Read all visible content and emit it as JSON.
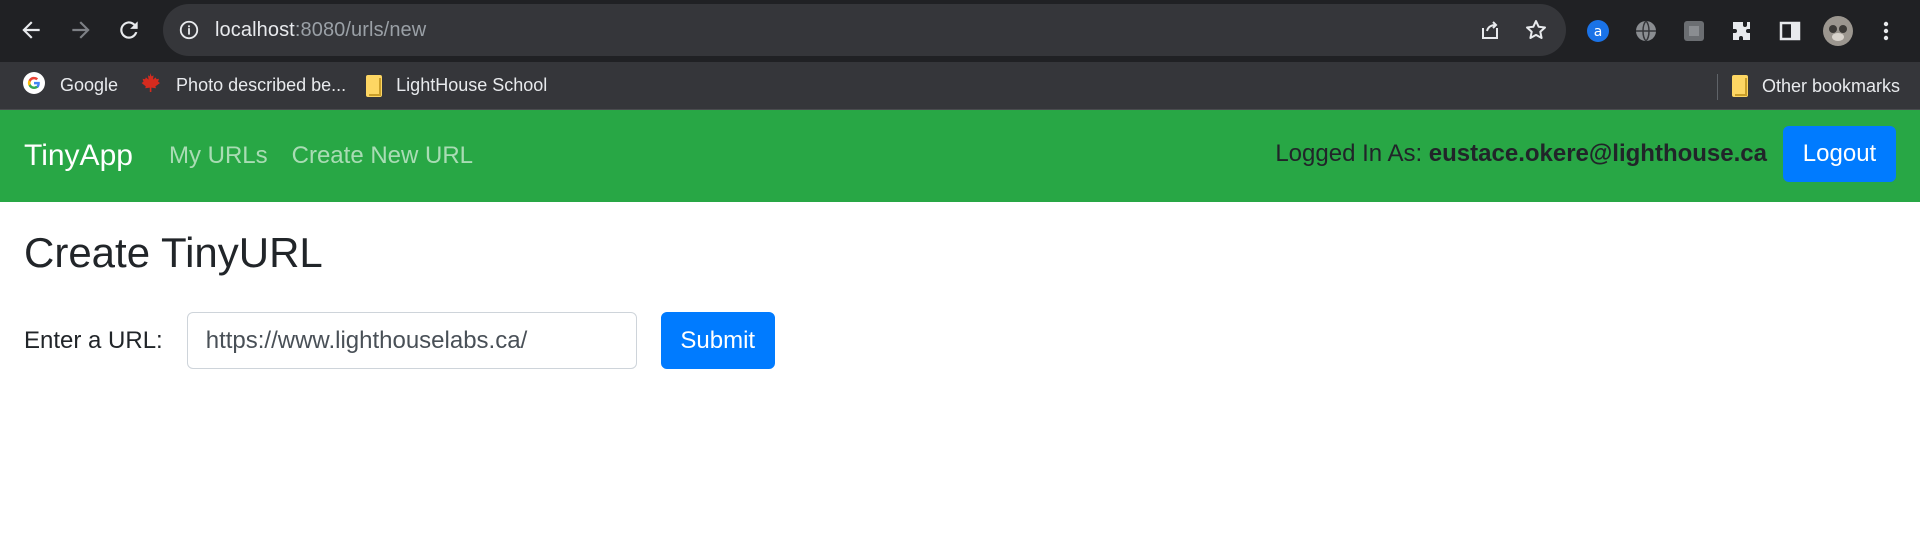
{
  "browser": {
    "url_host": "localhost",
    "url_rest": ":8080/urls/new",
    "bookmarks": [
      {
        "label": "Google",
        "icon": "google-icon"
      },
      {
        "label": "Photo described be...",
        "icon": "maple-leaf-icon"
      },
      {
        "label": "LightHouse School",
        "icon": "folder-icon"
      }
    ],
    "other_bookmarks": "Other bookmarks"
  },
  "navbar": {
    "brand": "TinyApp",
    "links": [
      "My URLs",
      "Create New URL"
    ],
    "logged_in_prefix": "Logged In As:",
    "user_email": "eustace.okere@lighthouse.ca",
    "logout_label": "Logout",
    "color": "#28a745"
  },
  "main": {
    "title": "Create TinyURL",
    "url_label": "Enter a URL:",
    "url_value": "https://www.lighthouselabs.ca/",
    "submit_label": "Submit",
    "button_color": "#007bff"
  }
}
